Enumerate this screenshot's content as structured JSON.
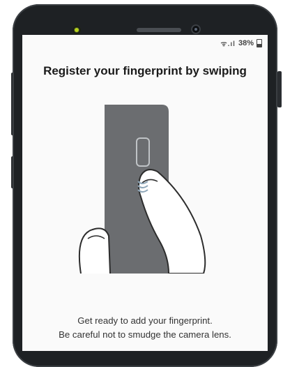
{
  "status_bar": {
    "signal_icons": "ᯤ.ıl",
    "battery_percent": "38%"
  },
  "title": "Register your fingerprint by swiping",
  "instructions": {
    "line1": "Get ready to add your fingerprint.",
    "line2": "Be careful not to smudge the camera lens."
  },
  "colors": {
    "phone_body": "#1e2124",
    "screen_bg": "#fafafa",
    "illustration_phone": "#6b6d70",
    "sensor_accent": "#8ea6b8"
  }
}
